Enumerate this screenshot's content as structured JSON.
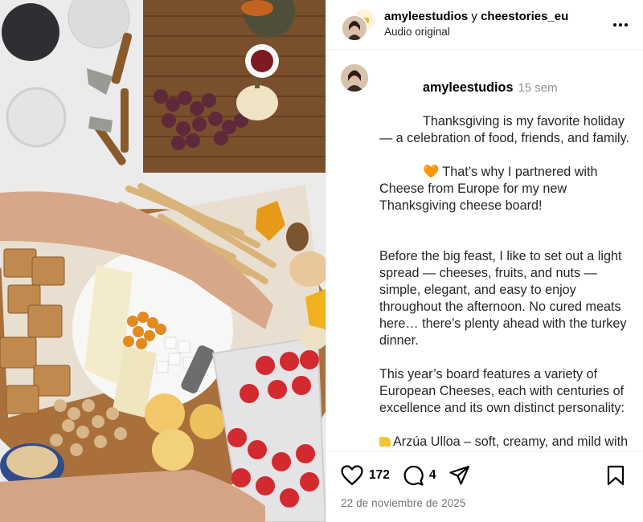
{
  "header": {
    "user1": "amyleestudios",
    "conjunction": "y",
    "user2": "cheestories_eu",
    "audio": "Audio original",
    "more_icon": "more-horizontal-icon"
  },
  "caption": {
    "username": "amyleestudios",
    "time": "15 sem",
    "paragraphs": [
      "Thanksgiving is my favorite holiday — a celebration of food, friends, and family.",
      "That’s why I partnered with Cheese from Europe for my new Thanksgiving cheese board!",
      "Before the big feast, I like to set out a light spread — cheeses, fruits, and nuts — simple, elegant, and easy to enjoy throughout the afternoon. No cured meats here… there’s plenty ahead with the turkey dinner.",
      "This year’s board features a variety of European Cheeses, each with centuries of excellence and its own distinct personality:",
      "Arzúa Ulloa – soft, creamy, and mild with a delicate milky sweetness. Often described as buttery and mellow — the kind of cheese guests can’t stop"
    ],
    "heart_emoji": "🧡"
  },
  "actions": {
    "likes": "172",
    "comments": "4",
    "like_icon": "heart-icon",
    "comment_icon": "comment-icon",
    "share_icon": "share-icon",
    "save_icon": "bookmark-icon"
  },
  "date": "22 de noviembre de 2025",
  "colors": {
    "heart_orange": "#f0821f",
    "muted": "#8e8e8e",
    "border": "#efefef"
  }
}
